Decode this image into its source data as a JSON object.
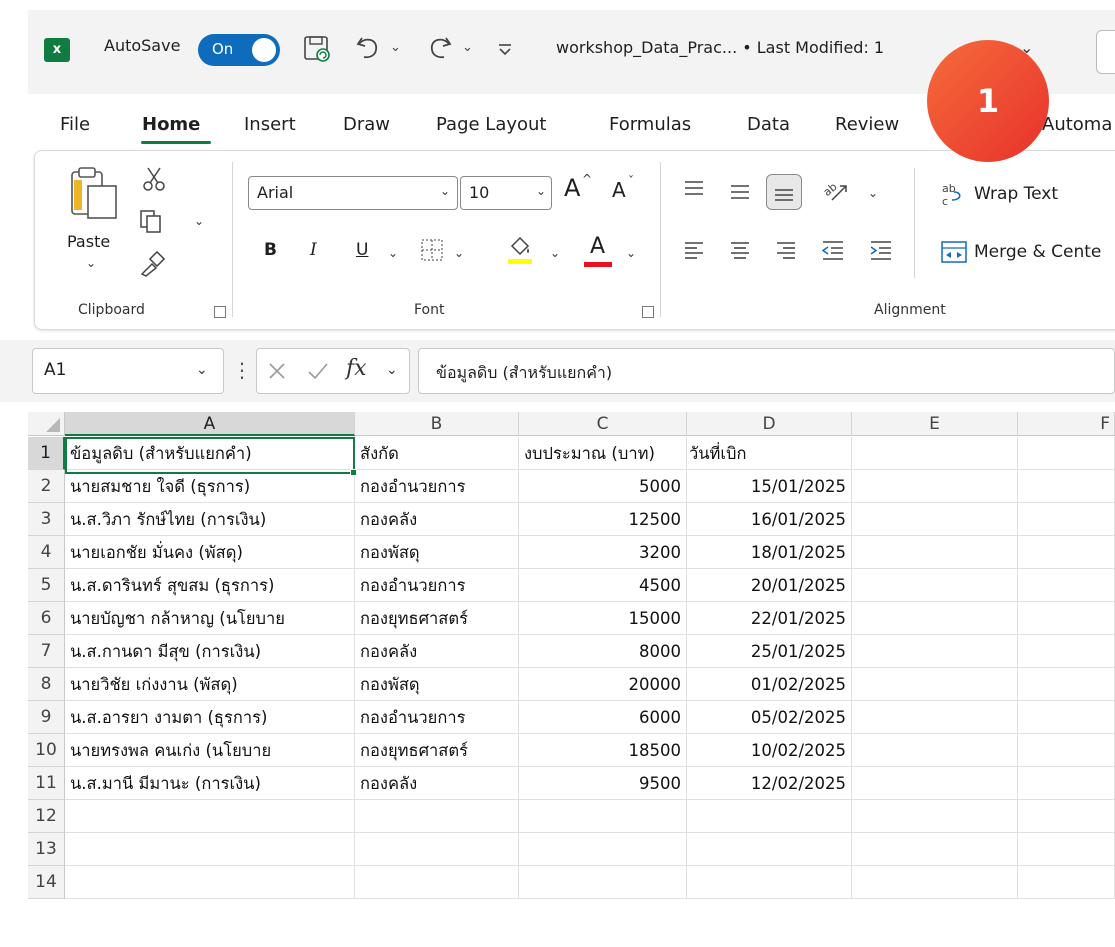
{
  "titlebar": {
    "app_icon": "excel-logo-icon",
    "app_letter": "x",
    "autosave_label": "AutoSave",
    "autosave_state": "On",
    "doc_title": "workshop_Data_Prac... • Last Modified: 1",
    "title_chevron": "⌄",
    "badge": "1"
  },
  "menu": {
    "tabs": [
      "File",
      "Home",
      "Insert",
      "Draw",
      "Page Layout",
      "Formulas",
      "Data",
      "Review",
      "Automa"
    ],
    "active": "Home"
  },
  "ribbon": {
    "clipboard": {
      "label": "Clipboard",
      "paste": "Paste"
    },
    "font": {
      "label": "Font",
      "family": "Arial",
      "size": "10",
      "bold": "B",
      "italic": "I",
      "underline": "U",
      "grow": "A",
      "shrink": "A",
      "color_letter": "A",
      "font_color": "#e81123",
      "highlight_color": "#ffff00"
    },
    "alignment": {
      "label": "Alignment",
      "wrap_text": "Wrap Text",
      "merge_center": "Merge & Cente"
    }
  },
  "formula_bar": {
    "name_box": "A1",
    "fx": "fx",
    "content": "ข้อมูลดิบ (สำหรับแยกคำ)"
  },
  "sheet": {
    "columns": [
      "A",
      "B",
      "C",
      "D",
      "E",
      "F"
    ],
    "selected_cell": "A1",
    "rows": [
      {
        "n": "1",
        "a": "ข้อมูลดิบ (สำหรับแยกคำ)",
        "b": "สังกัด",
        "c": "งบประมาณ (บาท)",
        "d": "วันที่เบิก"
      },
      {
        "n": "2",
        "a": "นายสมชาย ใจดี (ธุรการ)",
        "b": "กองอำนวยการ",
        "c": "5000",
        "d": "15/01/2025"
      },
      {
        "n": "3",
        "a": "น.ส.วิภา รักษ์ไทย (การเงิน)",
        "b": "กองคลัง",
        "c": "12500",
        "d": "16/01/2025"
      },
      {
        "n": "4",
        "a": "นายเอกชัย มั่นคง (พัสดุ)",
        "b": "กองพัสดุ",
        "c": "3200",
        "d": "18/01/2025"
      },
      {
        "n": "5",
        "a": "น.ส.ดารินทร์ สุขสม (ธุรการ)",
        "b": "กองอำนวยการ",
        "c": "4500",
        "d": "20/01/2025"
      },
      {
        "n": "6",
        "a": "นายบัญชา กล้าหาญ (นโยบาย",
        "b": "กองยุทธศาสตร์",
        "c": "15000",
        "d": "22/01/2025"
      },
      {
        "n": "7",
        "a": "น.ส.กานดา มีสุข (การเงิน)",
        "b": "กองคลัง",
        "c": "8000",
        "d": "25/01/2025"
      },
      {
        "n": "8",
        "a": "นายวิชัย เก่งงาน (พัสดุ)",
        "b": "กองพัสดุ",
        "c": "20000",
        "d": "01/02/2025"
      },
      {
        "n": "9",
        "a": "น.ส.อารยา งามตา (ธุรการ)",
        "b": "กองอำนวยการ",
        "c": "6000",
        "d": "05/02/2025"
      },
      {
        "n": "10",
        "a": "นายทรงพล คนเก่ง (นโยบาย",
        "b": "กองยุทธศาสตร์",
        "c": "18500",
        "d": "10/02/2025"
      },
      {
        "n": "11",
        "a": "น.ส.มานี มีมานะ (การเงิน)",
        "b": "กองคลัง",
        "c": "9500",
        "d": "12/02/2025"
      },
      {
        "n": "12",
        "a": "",
        "b": "",
        "c": "",
        "d": ""
      },
      {
        "n": "13",
        "a": "",
        "b": "",
        "c": "",
        "d": ""
      },
      {
        "n": "14",
        "a": "",
        "b": "",
        "c": "",
        "d": ""
      }
    ]
  }
}
